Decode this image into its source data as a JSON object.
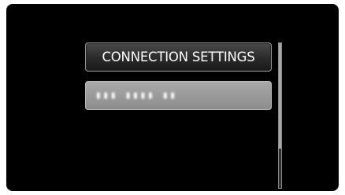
{
  "menu": {
    "items": [
      {
        "label": "CONNECTION SETTINGS",
        "selected": true
      },
      {
        "label": "▮▮▮ ▮▮▮▮ ▮▮",
        "selected": false,
        "obscured": true
      }
    ]
  },
  "scrollbar": {
    "position_fraction": 0.0,
    "visible_fraction": 0.73
  },
  "colors": {
    "screen_background": "#000000",
    "selected_item": "#2a2a2a",
    "secondary_item": "#9a9a9a",
    "text": "#ffffff"
  }
}
